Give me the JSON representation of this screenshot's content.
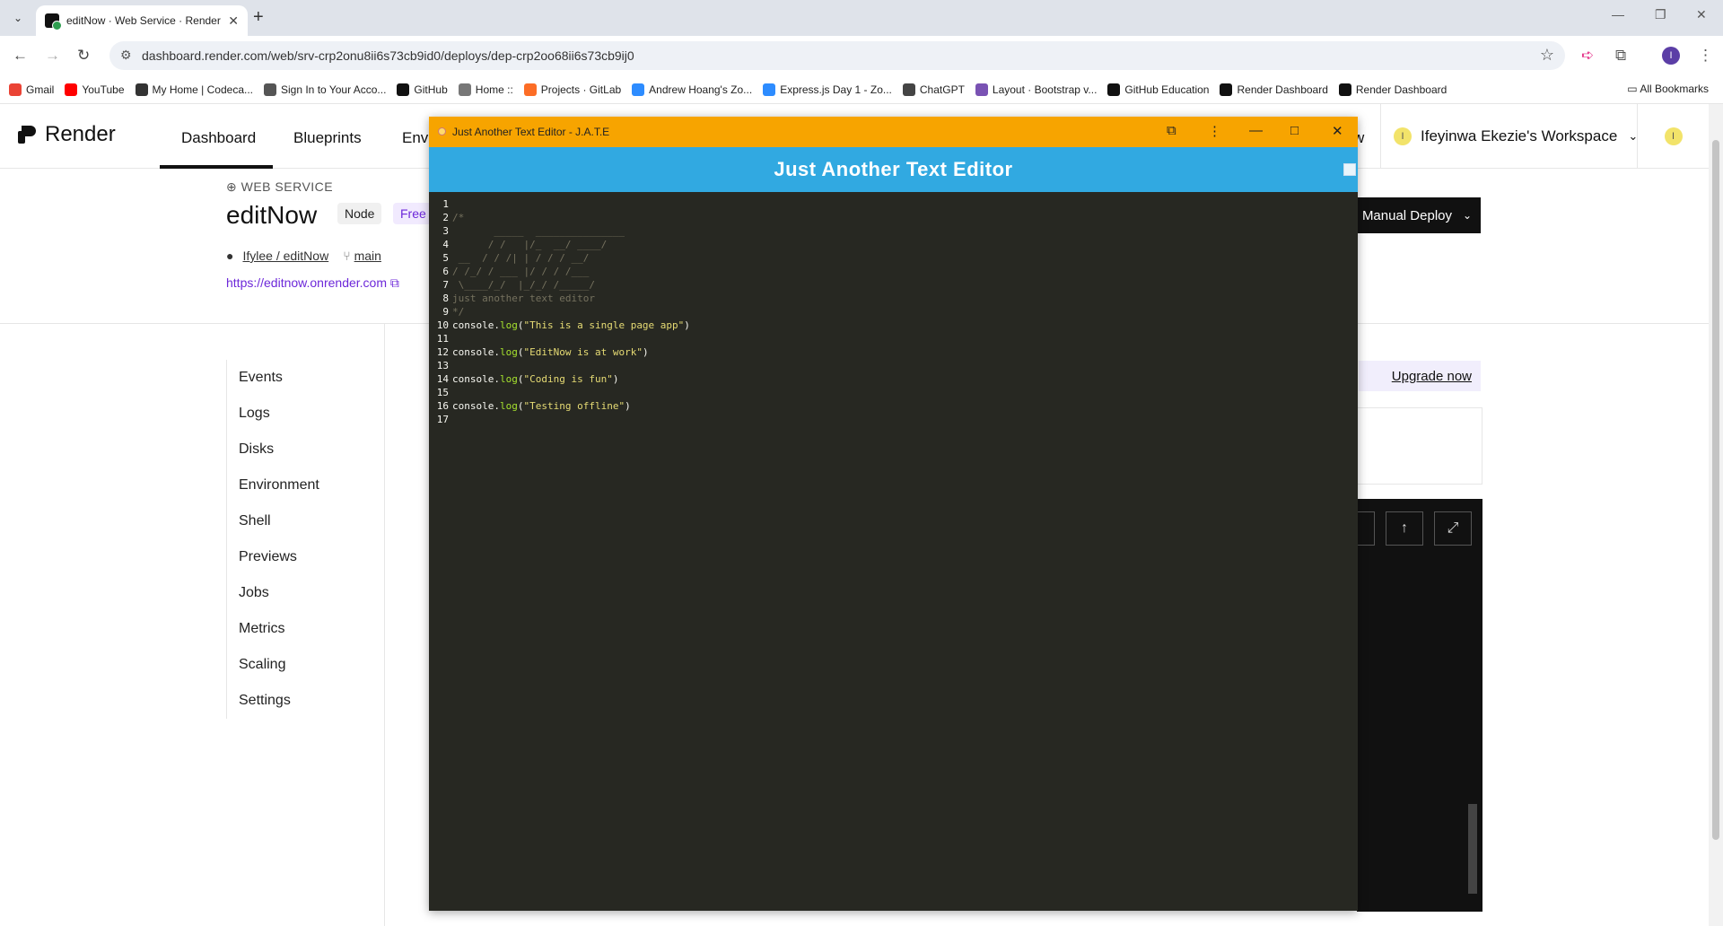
{
  "browser": {
    "tab_title": "editNow · Web Service · Render",
    "url": "dashboard.render.com/web/srv-crp2onu8ii6s73cb9id0/deploys/dep-crp2oo68ii6s73cb9ij0",
    "bookmarks": [
      {
        "label": "Gmail",
        "color": "#ea4335"
      },
      {
        "label": "YouTube",
        "color": "#ff0000"
      },
      {
        "label": "My Home | Codeca...",
        "color": "#333333"
      },
      {
        "label": "Sign In to Your Acco...",
        "color": "#555555"
      },
      {
        "label": "GitHub",
        "color": "#111111"
      },
      {
        "label": "Home ::",
        "color": "#777777"
      },
      {
        "label": "Projects · GitLab",
        "color": "#fc6d26"
      },
      {
        "label": "Andrew Hoang's Zo...",
        "color": "#2d8cff"
      },
      {
        "label": "Express.js Day 1 - Zo...",
        "color": "#2d8cff"
      },
      {
        "label": "ChatGPT",
        "color": "#444444"
      },
      {
        "label": "Layout · Bootstrap v...",
        "color": "#7952b3"
      },
      {
        "label": "GitHub Education",
        "color": "#111111"
      },
      {
        "label": "Render Dashboard",
        "color": "#111111"
      },
      {
        "label": "Render Dashboard",
        "color": "#111111"
      }
    ],
    "all_bookmarks": "All Bookmarks",
    "profile_initial": "I"
  },
  "render": {
    "brand": "Render",
    "nav": [
      "Dashboard",
      "Blueprints",
      "Env"
    ],
    "nav_hidden_tail": "w",
    "workspace": "Ifeyinwa Ekezie's Workspace",
    "workspace_initial": "I",
    "service_type": "WEB SERVICE",
    "service_name": "editNow",
    "badges": [
      "Node",
      "Free"
    ],
    "repo": "Ifylee / editNow",
    "branch": "main",
    "service_url": "https://editnow.onrender.com",
    "manual_deploy": "Manual Deploy",
    "sidebar": [
      "Events",
      "Logs",
      "Disks",
      "Environment",
      "Shell",
      "Previews",
      "Jobs",
      "Metrics",
      "Scaling",
      "Settings"
    ],
    "upgrade": "Upgrade now"
  },
  "jate": {
    "window_title": "Just Another Text Editor - J.A.T.E",
    "header": "Just Another Text Editor",
    "lines": [
      {
        "n": "1",
        "parts": []
      },
      {
        "n": "2",
        "parts": [
          {
            "t": "/*",
            "c": "cm"
          }
        ]
      },
      {
        "n": "3",
        "parts": [
          {
            "t": "       _____  _______________",
            "c": "cm"
          }
        ]
      },
      {
        "n": "4",
        "parts": [
          {
            "t": "      / /   |/_  __/ ____/",
            "c": "cm"
          }
        ]
      },
      {
        "n": "5",
        "parts": [
          {
            "t": " __  / / /| | / / / __/",
            "c": "cm"
          }
        ]
      },
      {
        "n": "6",
        "parts": [
          {
            "t": "/ /_/ / ___ |/ / / /___",
            "c": "cm"
          }
        ]
      },
      {
        "n": "7",
        "parts": [
          {
            "t": " \\____/_/  |_/_/ /_____/",
            "c": "cm"
          }
        ]
      },
      {
        "n": "8",
        "parts": [
          {
            "t": "just another text editor",
            "c": "cm"
          }
        ]
      },
      {
        "n": "9",
        "parts": [
          {
            "t": "*/",
            "c": "cm"
          }
        ]
      },
      {
        "n": "10",
        "parts": [
          {
            "t": "console.",
            "c": "code"
          },
          {
            "t": "log",
            "c": "fn"
          },
          {
            "t": "(",
            "c": "code"
          },
          {
            "t": "\"This is a single page app\"",
            "c": "str"
          },
          {
            "t": ")",
            "c": "code"
          }
        ]
      },
      {
        "n": "11",
        "parts": []
      },
      {
        "n": "12",
        "parts": [
          {
            "t": "console.",
            "c": "code"
          },
          {
            "t": "log",
            "c": "fn"
          },
          {
            "t": "(",
            "c": "code"
          },
          {
            "t": "\"EditNow is at work\"",
            "c": "str"
          },
          {
            "t": ")",
            "c": "code"
          }
        ]
      },
      {
        "n": "13",
        "parts": []
      },
      {
        "n": "14",
        "parts": [
          {
            "t": "console.",
            "c": "code"
          },
          {
            "t": "log",
            "c": "fn"
          },
          {
            "t": "(",
            "c": "code"
          },
          {
            "t": "\"Coding is fun\"",
            "c": "str"
          },
          {
            "t": ")",
            "c": "code"
          }
        ]
      },
      {
        "n": "15",
        "parts": []
      },
      {
        "n": "16",
        "parts": [
          {
            "t": "console.",
            "c": "code"
          },
          {
            "t": "log",
            "c": "fn"
          },
          {
            "t": "(",
            "c": "code"
          },
          {
            "t": "\"Testing offline\"",
            "c": "str"
          },
          {
            "t": ")",
            "c": "code"
          }
        ]
      },
      {
        "n": "17",
        "parts": []
      }
    ]
  },
  "colors": {
    "jate_titlebar": "#f7a400",
    "jate_header": "#31a9e1",
    "editor_bg": "#272822",
    "link_purple": "#6d28d9"
  }
}
